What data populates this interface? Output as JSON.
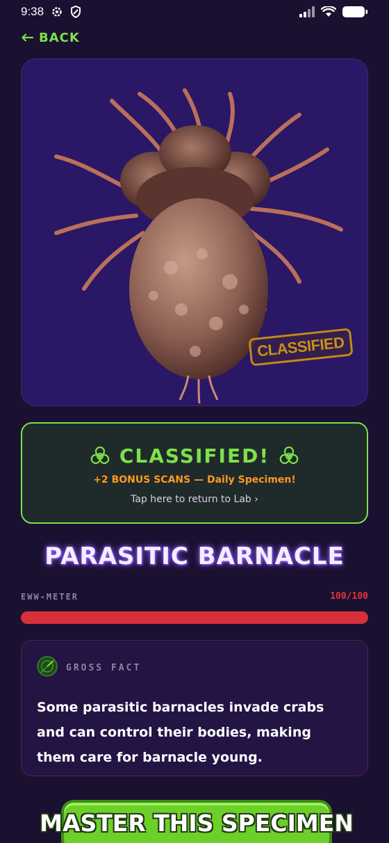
{
  "status_bar": {
    "time": "9:38"
  },
  "nav": {
    "back_label": "BACK"
  },
  "specimen": {
    "image_alt": "parasitic barnacle creature",
    "stamp_label": "CLASSIFIED",
    "name": "PARASITIC BARNACLE"
  },
  "banner": {
    "title": "CLASSIFIED!",
    "bonus": "+2 BONUS SCANS — Daily Specimen!",
    "tap_text": "Tap here to return to Lab ›"
  },
  "eww_meter": {
    "label": "EWW-METER",
    "value_text": "100/100",
    "fraction": 1.0
  },
  "gross_fact": {
    "label": "GROSS FACT",
    "text": "Some parasitic barnacles invade crabs and can control their bodies, making them care for barnacle young."
  },
  "cta": {
    "label": "MASTER THIS SPECIMEN"
  },
  "colors": {
    "background": "#1a1030",
    "accent_green": "#7ee04a",
    "bonus_orange": "#ff9a1f",
    "eww_red": "#d8303a",
    "card_purple": "#2a1766"
  }
}
